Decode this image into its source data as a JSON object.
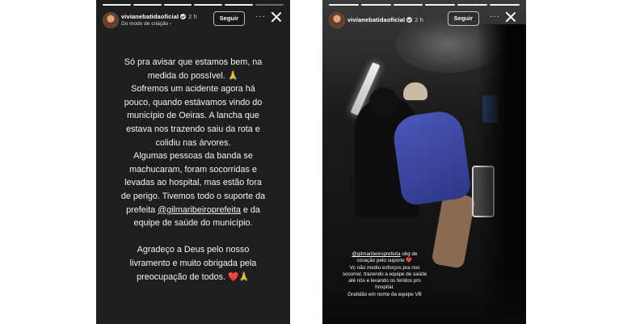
{
  "story_left": {
    "username": "vivianebatidaoficial",
    "time": "2 h",
    "subtitle": "Do modo de criação",
    "subtitle_chevron": "›",
    "follow_label": "Seguir",
    "more_label": "···",
    "lines": [
      "Só pra avisar que estamos bem, na",
      "medida do possível. 🙏",
      "Sofremos um acidente agora há",
      "pouco, quando estávamos vindo do",
      "município de Oeiras. A lancha que",
      "estava nos trazendo saiu da rota e",
      "colidiu nas árvores.",
      "Algumas pessoas da banda se",
      "machucaram, foram socorridas e",
      "levadas ao hospital, mas estão fora",
      "de perigo. Tivemos todo o suporte da"
    ],
    "mention": "@gilmaribeiroprefeita",
    "mention_suffix": " e da",
    "line_after_mention": "equipe de saúde do município.",
    "closing_lines": [
      "Agradeço a Deus pelo nosso",
      "livramento e muito obrigada pela"
    ],
    "last_line_text": "preocupação de todos.",
    "last_line_emoji": "❤️🙏",
    "prefix_before_mention": "prefeita "
  },
  "story_right": {
    "username": "vivianebatidaoficial",
    "time": "2 h",
    "follow_label": "Seguir",
    "more_label": "···",
    "caption_mention": "@gilmaribeiroprefeita",
    "caption_line1_suffix": " obg de",
    "caption_line2": "coração pelo suporte",
    "caption_heart": "❤️",
    "caption_lines": [
      "Vc não mediu esforços pra nos",
      "socorrer, trazendo a equipe de saúde",
      "até nós e levando os feridos pro",
      "hospital.",
      "Gratidão em nome da equipe VB"
    ]
  }
}
